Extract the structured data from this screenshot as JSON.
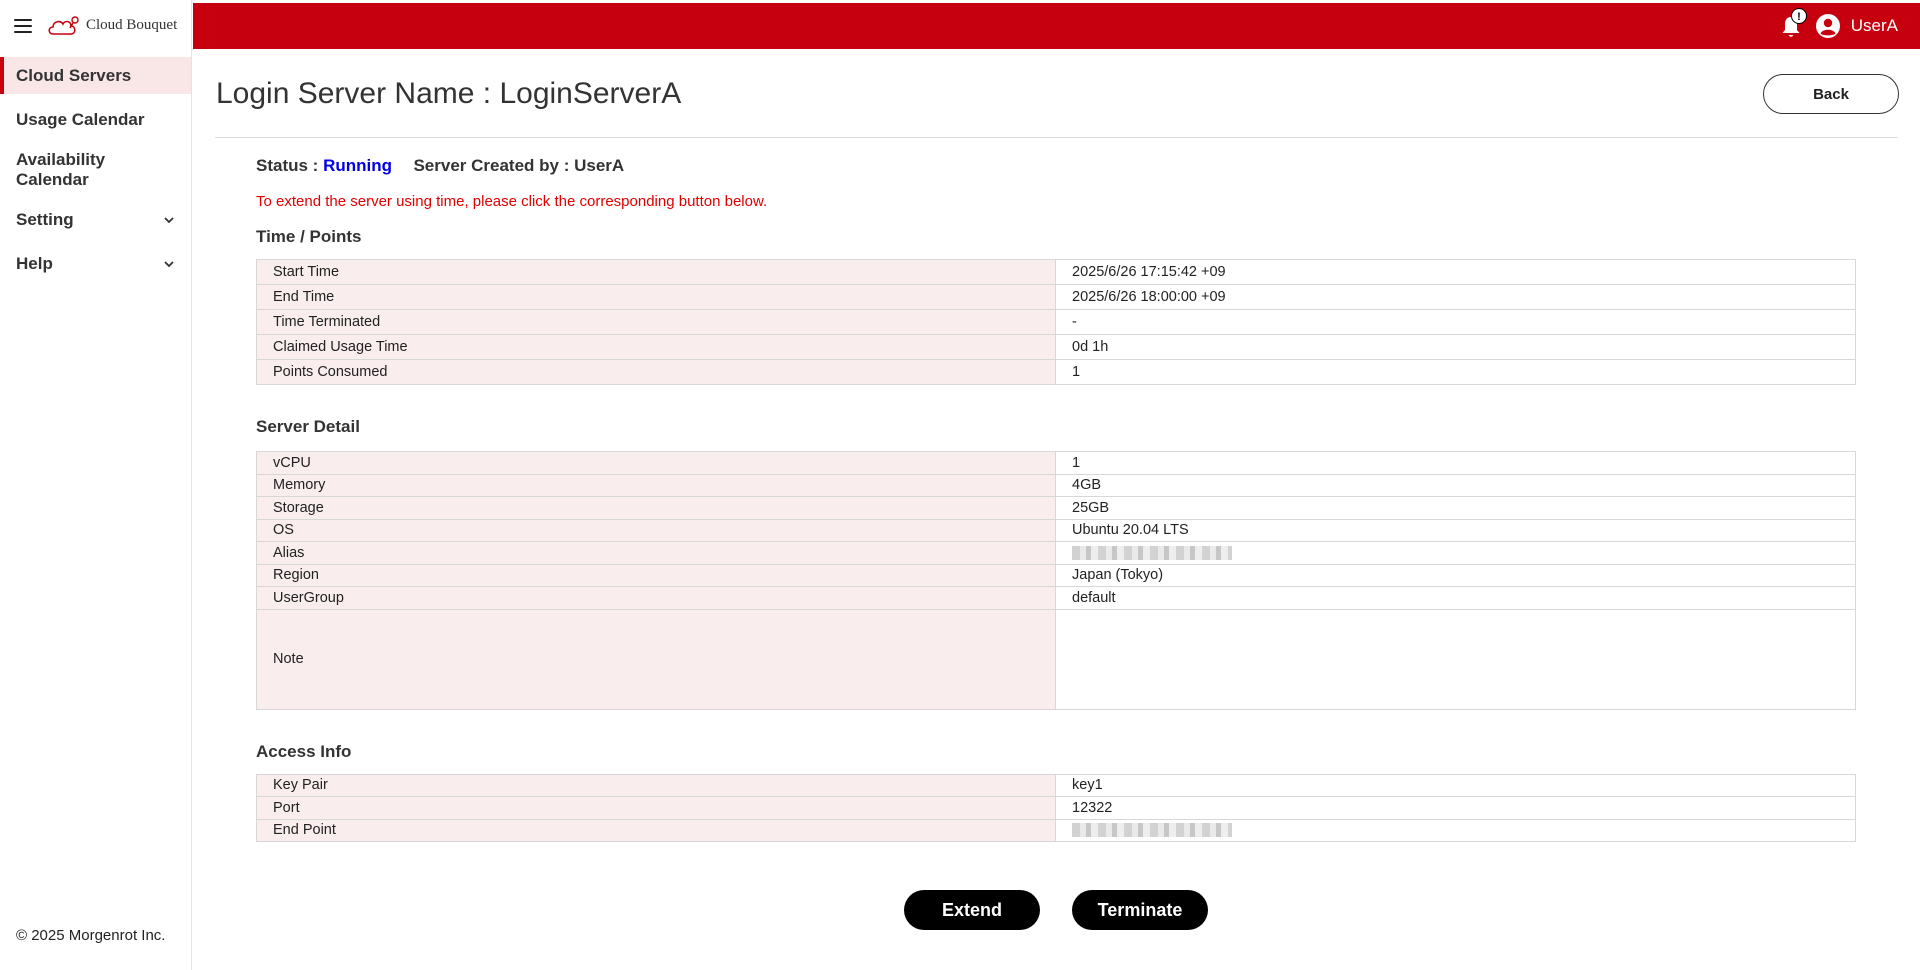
{
  "brand": {
    "name": "Cloud Bouquet"
  },
  "sidebar": {
    "items": [
      {
        "label": "Cloud Servers"
      },
      {
        "label": "Usage Calendar"
      },
      {
        "label": "Availability Calendar"
      },
      {
        "label": "Setting"
      },
      {
        "label": "Help"
      }
    ],
    "copyright": "© 2025 Morgenrot Inc."
  },
  "header": {
    "badge": "!",
    "user": "UserA",
    "accent_color": "#c7000f"
  },
  "page": {
    "title": "Login Server Name : LoginServerA",
    "back_label": "Back",
    "status_label": "Status :",
    "status_value": "Running",
    "created_by_label": "Server Created by :",
    "created_by_value": "UserA",
    "notice": "To extend the server using time, please click the corresponding button below."
  },
  "time_points": {
    "title": "Time / Points",
    "rows": [
      {
        "key": "Start Time",
        "value": "2025/6/26 17:15:42 +09"
      },
      {
        "key": "End Time",
        "value": "2025/6/26 18:00:00 +09"
      },
      {
        "key": "Time Terminated",
        "value": "-"
      },
      {
        "key": "Claimed Usage Time",
        "value": "0d 1h"
      },
      {
        "key": "Points Consumed",
        "value": "1"
      }
    ]
  },
  "server_detail": {
    "title": "Server Detail",
    "rows": [
      {
        "key": "vCPU",
        "value": "1"
      },
      {
        "key": "Memory",
        "value": "4GB"
      },
      {
        "key": "Storage",
        "value": "25GB"
      },
      {
        "key": "OS",
        "value": "Ubuntu 20.04 LTS"
      },
      {
        "key": "Alias",
        "value": ""
      },
      {
        "key": "Region",
        "value": "Japan (Tokyo)"
      },
      {
        "key": "UserGroup",
        "value": "default"
      },
      {
        "key": "Note",
        "value": ""
      }
    ]
  },
  "access_info": {
    "title": "Access Info",
    "rows": [
      {
        "key": "Key Pair",
        "value": "key1"
      },
      {
        "key": "Port",
        "value": "12322"
      },
      {
        "key": "End Point",
        "value": ""
      }
    ]
  },
  "actions": {
    "extend_label": "Extend",
    "terminate_label": "Terminate"
  }
}
